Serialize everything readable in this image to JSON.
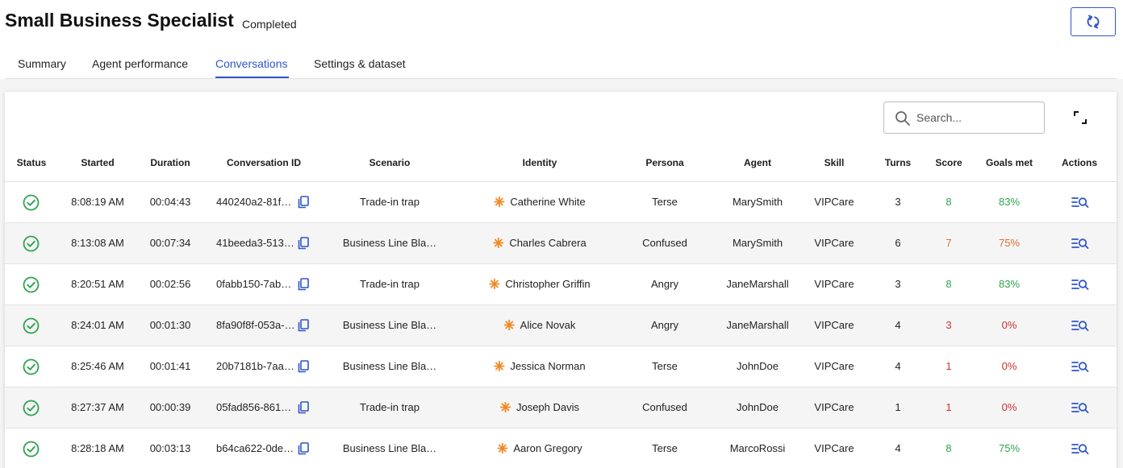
{
  "header": {
    "title": "Small Business Specialist",
    "status": "Completed"
  },
  "tabs": [
    {
      "label": "Summary",
      "active": false
    },
    {
      "label": "Agent performance",
      "active": false
    },
    {
      "label": "Conversations",
      "active": true
    },
    {
      "label": "Settings & dataset",
      "active": false
    }
  ],
  "search": {
    "placeholder": "Search...",
    "value": ""
  },
  "colors": {
    "accent": "#2f57c7",
    "success": "#2ea44f",
    "warning": "#e0702e",
    "danger": "#d0302f",
    "identity_star": "#f08a24"
  },
  "table": {
    "columns": [
      "Status",
      "Started",
      "Duration",
      "Conversation ID",
      "Scenario",
      "Identity",
      "Persona",
      "Agent",
      "Skill",
      "Turns",
      "Score",
      "Goals met",
      "Actions"
    ],
    "rows": [
      {
        "status": "completed",
        "started": "8:08:19 AM",
        "duration": "00:04:43",
        "conversation_id": "440240a2-81f…",
        "scenario": "Trade-in trap",
        "identity": "Catherine White",
        "persona": "Terse",
        "agent": "MarySmith",
        "skill": "VIPCare",
        "turns": "3",
        "score": "8",
        "score_level": "success",
        "goals_met": "83%",
        "goals_level": "success"
      },
      {
        "status": "completed",
        "started": "8:13:08 AM",
        "duration": "00:07:34",
        "conversation_id": "41beeda3-513…",
        "scenario": "Business Line Bla…",
        "identity": "Charles Cabrera",
        "persona": "Confused",
        "agent": "MarySmith",
        "skill": "VIPCare",
        "turns": "6",
        "score": "7",
        "score_level": "warning",
        "goals_met": "75%",
        "goals_level": "warning"
      },
      {
        "status": "completed",
        "started": "8:20:51 AM",
        "duration": "00:02:56",
        "conversation_id": "0fabb150-7ab…",
        "scenario": "Trade-in trap",
        "identity": "Christopher Griffin",
        "persona": "Angry",
        "agent": "JaneMarshall",
        "skill": "VIPCare",
        "turns": "3",
        "score": "8",
        "score_level": "success",
        "goals_met": "83%",
        "goals_level": "success"
      },
      {
        "status": "completed",
        "started": "8:24:01 AM",
        "duration": "00:01:30",
        "conversation_id": "8fa90f8f-053a-…",
        "scenario": "Business Line Bla…",
        "identity": "Alice Novak",
        "persona": "Angry",
        "agent": "JaneMarshall",
        "skill": "VIPCare",
        "turns": "4",
        "score": "3",
        "score_level": "danger",
        "goals_met": "0%",
        "goals_level": "danger"
      },
      {
        "status": "completed",
        "started": "8:25:46 AM",
        "duration": "00:01:41",
        "conversation_id": "20b7181b-7aa…",
        "scenario": "Business Line Bla…",
        "identity": "Jessica Norman",
        "persona": "Terse",
        "agent": "JohnDoe",
        "skill": "VIPCare",
        "turns": "4",
        "score": "1",
        "score_level": "danger",
        "goals_met": "0%",
        "goals_level": "danger"
      },
      {
        "status": "completed",
        "started": "8:27:37 AM",
        "duration": "00:00:39",
        "conversation_id": "05fad856-861…",
        "scenario": "Trade-in trap",
        "identity": "Joseph Davis",
        "persona": "Confused",
        "agent": "JohnDoe",
        "skill": "VIPCare",
        "turns": "1",
        "score": "1",
        "score_level": "danger",
        "goals_met": "0%",
        "goals_level": "danger"
      },
      {
        "status": "completed",
        "started": "8:28:18 AM",
        "duration": "00:03:13",
        "conversation_id": "b64ca622-0de…",
        "scenario": "Business Line Bla…",
        "identity": "Aaron Gregory",
        "persona": "Terse",
        "agent": "MarcoRossi",
        "skill": "VIPCare",
        "turns": "4",
        "score": "8",
        "score_level": "success",
        "goals_met": "75%",
        "goals_level": "success"
      }
    ]
  },
  "icons": {
    "refresh": "refresh-icon",
    "search": "search-icon",
    "expand": "expand-icon",
    "status": "check-circle-icon",
    "copy": "copy-icon",
    "identity": "asterisk-icon",
    "action": "search-list-icon"
  }
}
